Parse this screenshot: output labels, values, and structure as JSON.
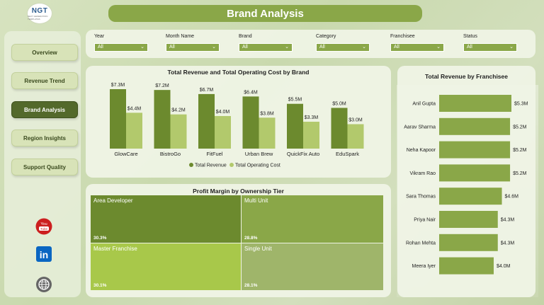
{
  "header": {
    "logo_text": "NGT",
    "logo_subtext": "NEXT GENERATION TEMPLATES",
    "title": "Brand Analysis"
  },
  "sidebar": {
    "items": [
      {
        "label": "Overview",
        "active": false
      },
      {
        "label": "Revenue Trend",
        "active": false
      },
      {
        "label": "Brand Analysis",
        "active": true
      },
      {
        "label": "Region Insights",
        "active": false
      },
      {
        "label": "Support Quality",
        "active": false
      }
    ],
    "social": [
      {
        "icon": "youtube-icon",
        "text": "You Tube",
        "color": "#cc1f1f"
      },
      {
        "icon": "linkedin-icon",
        "text": "in",
        "color": "#0a66c2"
      },
      {
        "icon": "globe-icon",
        "text": "",
        "color": "#555555"
      }
    ]
  },
  "filters": [
    {
      "label": "Year",
      "value": "All"
    },
    {
      "label": "Month Name",
      "value": "All"
    },
    {
      "label": "Brand",
      "value": "All"
    },
    {
      "label": "Category",
      "value": "All"
    },
    {
      "label": "Franchisee",
      "value": "All"
    },
    {
      "label": "Status",
      "value": "All"
    }
  ],
  "colors": {
    "accent": "#8aa748",
    "dark_bar": "#6c8a2e",
    "light_bar": "#b2c96c",
    "active_nav": "#53692b"
  },
  "chart_data": [
    {
      "type": "bar",
      "title": "Total Revenue and Total Operating Cost by Brand",
      "categories": [
        "GlowCare",
        "BistroGo",
        "FitFuel",
        "Urban Brew",
        "QuickFix Auto",
        "EduSpark"
      ],
      "series": [
        {
          "name": "Total Revenue",
          "values": [
            7.3,
            7.2,
            6.7,
            6.4,
            5.5,
            5.0
          ],
          "labels": [
            "$7.3M",
            "$7.2M",
            "$6.7M",
            "$6.4M",
            "$5.5M",
            "$5.0M"
          ],
          "color": "#6c8a2e"
        },
        {
          "name": "Total Operating Cost",
          "values": [
            4.4,
            4.2,
            4.0,
            3.8,
            3.3,
            3.0
          ],
          "labels": [
            "$4.4M",
            "$4.2M",
            "$4.0M",
            "$3.8M",
            "$3.3M",
            "$3.0M"
          ],
          "color": "#b2c96c"
        }
      ],
      "ylim": [
        0,
        8
      ],
      "legend": "bottom"
    },
    {
      "type": "bar",
      "orientation": "horizontal",
      "title": "Total Revenue by Franchisee",
      "categories": [
        "Anil Gupta",
        "Aarav Sharma",
        "Neha Kapoor",
        "Vikram Rao",
        "Sara Thomas",
        "Priya Nair",
        "Rohan Mehta",
        "Meera Iyer"
      ],
      "values": [
        5.3,
        5.2,
        5.2,
        5.2,
        4.6,
        4.3,
        4.3,
        4.0
      ],
      "labels": [
        "$5.3M",
        "$5.2M",
        "$5.2M",
        "$5.2M",
        "$4.6M",
        "$4.3M",
        "$4.3M",
        "$4.0M"
      ],
      "xlim": [
        0,
        5.3
      ]
    },
    {
      "type": "treemap",
      "title": "Profit Margin by Ownership Tier",
      "items": [
        {
          "name": "Area Developer",
          "value": 30.3,
          "label": "30.3%",
          "color": "#6c8a2e"
        },
        {
          "name": "Multi Unit",
          "value": 28.8,
          "label": "28.8%",
          "color": "#8aa748"
        },
        {
          "name": "Master Franchise",
          "value": 30.1,
          "label": "30.1%",
          "color": "#a8c84a"
        },
        {
          "name": "Single Unit",
          "value": 28.1,
          "label": "28.1%",
          "color": "#9fb56a"
        }
      ]
    }
  ]
}
